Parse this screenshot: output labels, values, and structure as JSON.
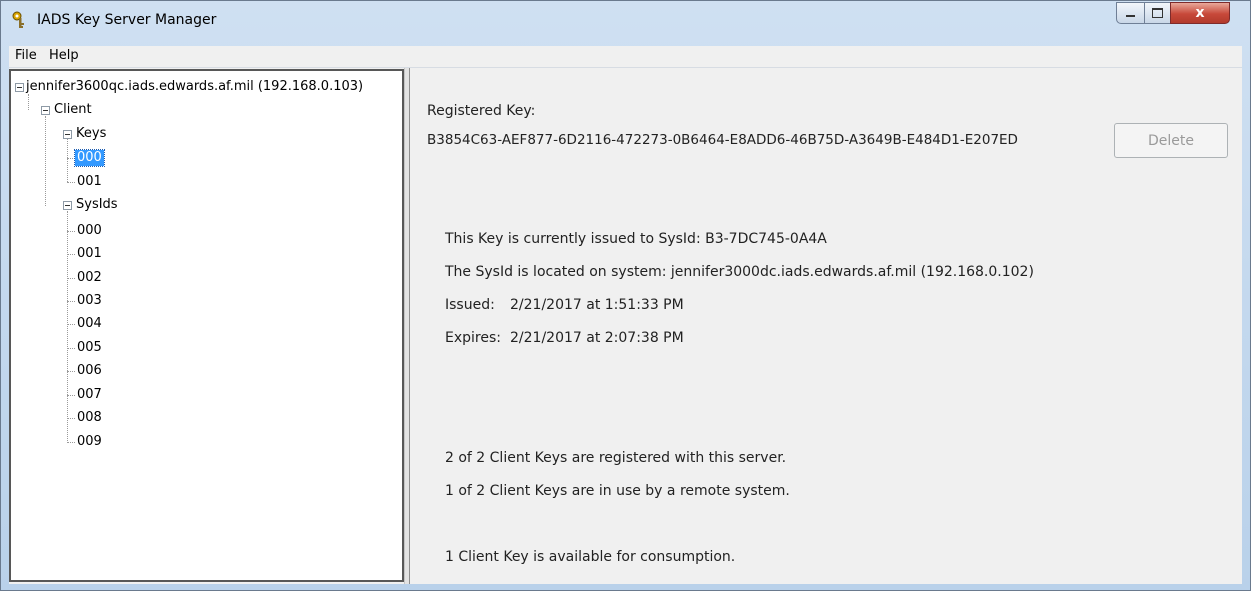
{
  "window": {
    "title": "IADS Key Server Manager",
    "close_glyph": "x"
  },
  "menu": [
    {
      "label": "File"
    },
    {
      "label": "Help"
    }
  ],
  "tree": {
    "root": "jennifer3600qc.iads.edwards.af.mil (192.168.0.103)",
    "client": "Client",
    "keys_label": "Keys",
    "keys": [
      "000",
      "001"
    ],
    "selected_key": "000",
    "sysids_label": "SysIds",
    "sysids": [
      "000",
      "001",
      "002",
      "003",
      "004",
      "005",
      "006",
      "007",
      "008",
      "009"
    ]
  },
  "detail": {
    "registered_key_label": "Registered Key:",
    "registered_key": "B3854C63-AEF877-6D2116-472273-0B6464-E8ADD6-46B75D-A3649B-E484D1-E207ED",
    "delete_label": "Delete",
    "issued_to": "This Key is currently issued to SysId: B3-7DC745-0A4A",
    "located_on": "The SysId is located on system: jennifer3000dc.iads.edwards.af.mil (192.168.0.102)",
    "issued_label": "Issued:",
    "issued_value": "2/21/2017 at 1:51:33 PM",
    "expires_label": "Expires:",
    "expires_value": "2/21/2017 at 2:07:38 PM",
    "registered_summary": "2 of 2 Client Keys are registered with this server.",
    "in_use_summary": "1 of 2 Client Keys are in use by a remote system.",
    "available_summary": "1 Client Key is available for consumption."
  }
}
